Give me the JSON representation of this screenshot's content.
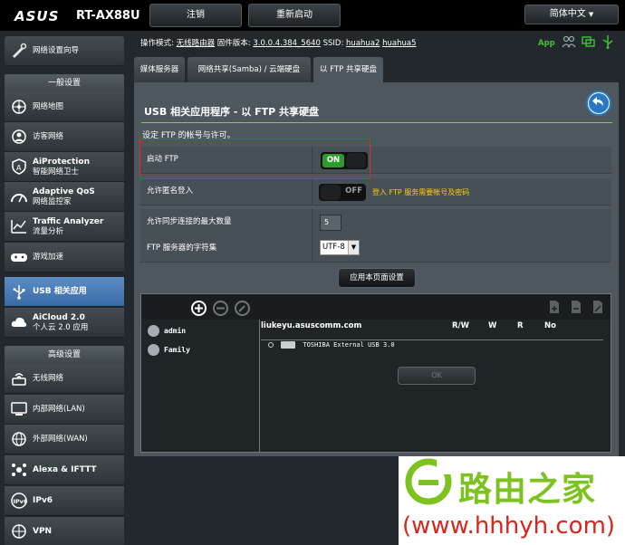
{
  "topbar": {
    "brand": "ASUS",
    "model": "RT-AX88U",
    "logout": "注销",
    "reboot": "重新启动",
    "language": "简体中文"
  },
  "status": {
    "mode_label": "操作模式:",
    "mode_value": "无线路由器",
    "fw_label": "固件版本:",
    "fw_value": "3.0.0.4.384_5640",
    "ssid_label": "SSID:",
    "ssid1": "huahua2",
    "ssid2": "huahua5",
    "app": "App"
  },
  "sidebar": {
    "wizard": "网络设置向导",
    "general_head": "一般设置",
    "general": [
      {
        "title": "网络地图",
        "sub": "",
        "icon": "network-map-icon"
      },
      {
        "title": "访客网络",
        "sub": "",
        "icon": "guest-network-icon"
      },
      {
        "title": "AiProtection",
        "sub": "智能网络卫士",
        "icon": "aiprotection-icon"
      },
      {
        "title": "Adaptive QoS",
        "sub": "网络监控家",
        "icon": "qos-icon"
      },
      {
        "title": "Traffic Analyzer",
        "sub": "流量分析",
        "icon": "traffic-analyzer-icon"
      },
      {
        "title": "游戏加速",
        "sub": "",
        "icon": "gamepad-icon"
      },
      {
        "title": "USB 相关应用",
        "sub": "",
        "icon": "usb-icon"
      },
      {
        "title": "AiCloud 2.0",
        "sub": "个人云 2.0 应用",
        "icon": "cloud-icon"
      }
    ],
    "advanced_head": "高级设置",
    "advanced": [
      {
        "title": "无线网络",
        "icon": "wireless-icon"
      },
      {
        "title": "内部网络(LAN)",
        "icon": "lan-icon"
      },
      {
        "title": "外部网络(WAN)",
        "icon": "wan-icon"
      },
      {
        "title": "Alexa & IFTTT",
        "icon": "alexa-icon"
      },
      {
        "title": "IPv6",
        "icon": "ipv6-icon"
      },
      {
        "title": "VPN",
        "icon": "vpn-icon"
      }
    ]
  },
  "tabs": [
    "媒体服务器",
    "网络共享(Samba) / 云端硬盘",
    "以 FTP 共享硬盘"
  ],
  "panel": {
    "title": "USB 相关应用程序 - 以 FTP 共享硬盘",
    "subtitle": "设定 FTP 的帐号与许可。",
    "rows": {
      "enable_ftp": "启动 FTP",
      "anonymous": "允许匿名登入",
      "max_conn": "允许同步连接的最大数量",
      "charset": "FTP 服务器的字符集"
    },
    "toggle_on": "ON",
    "toggle_off": "OFF",
    "anon_hint": "登入 FTP 服务需要帐号及密码",
    "max_conn_value": "5",
    "charset_value": "UTF-8",
    "apply": "应用本页面设置"
  },
  "accounts": {
    "users": [
      "admin",
      "Family"
    ],
    "host": "liukeyu.asuscomm.com",
    "cols": [
      "R/W",
      "W",
      "R",
      "No"
    ],
    "disk": "TOSHIBA External USB 3.0",
    "save": "OK"
  },
  "watermark": {
    "cn": "路由之家",
    "url": "(www.hhhyh.com)"
  },
  "colors": {
    "accent_green": "#90c83e",
    "active_blue": "#4b7cb8",
    "toggle_on": "#2e9a2c",
    "hint_yellow": "#ffcc00",
    "highlight_red": "#e42727"
  }
}
